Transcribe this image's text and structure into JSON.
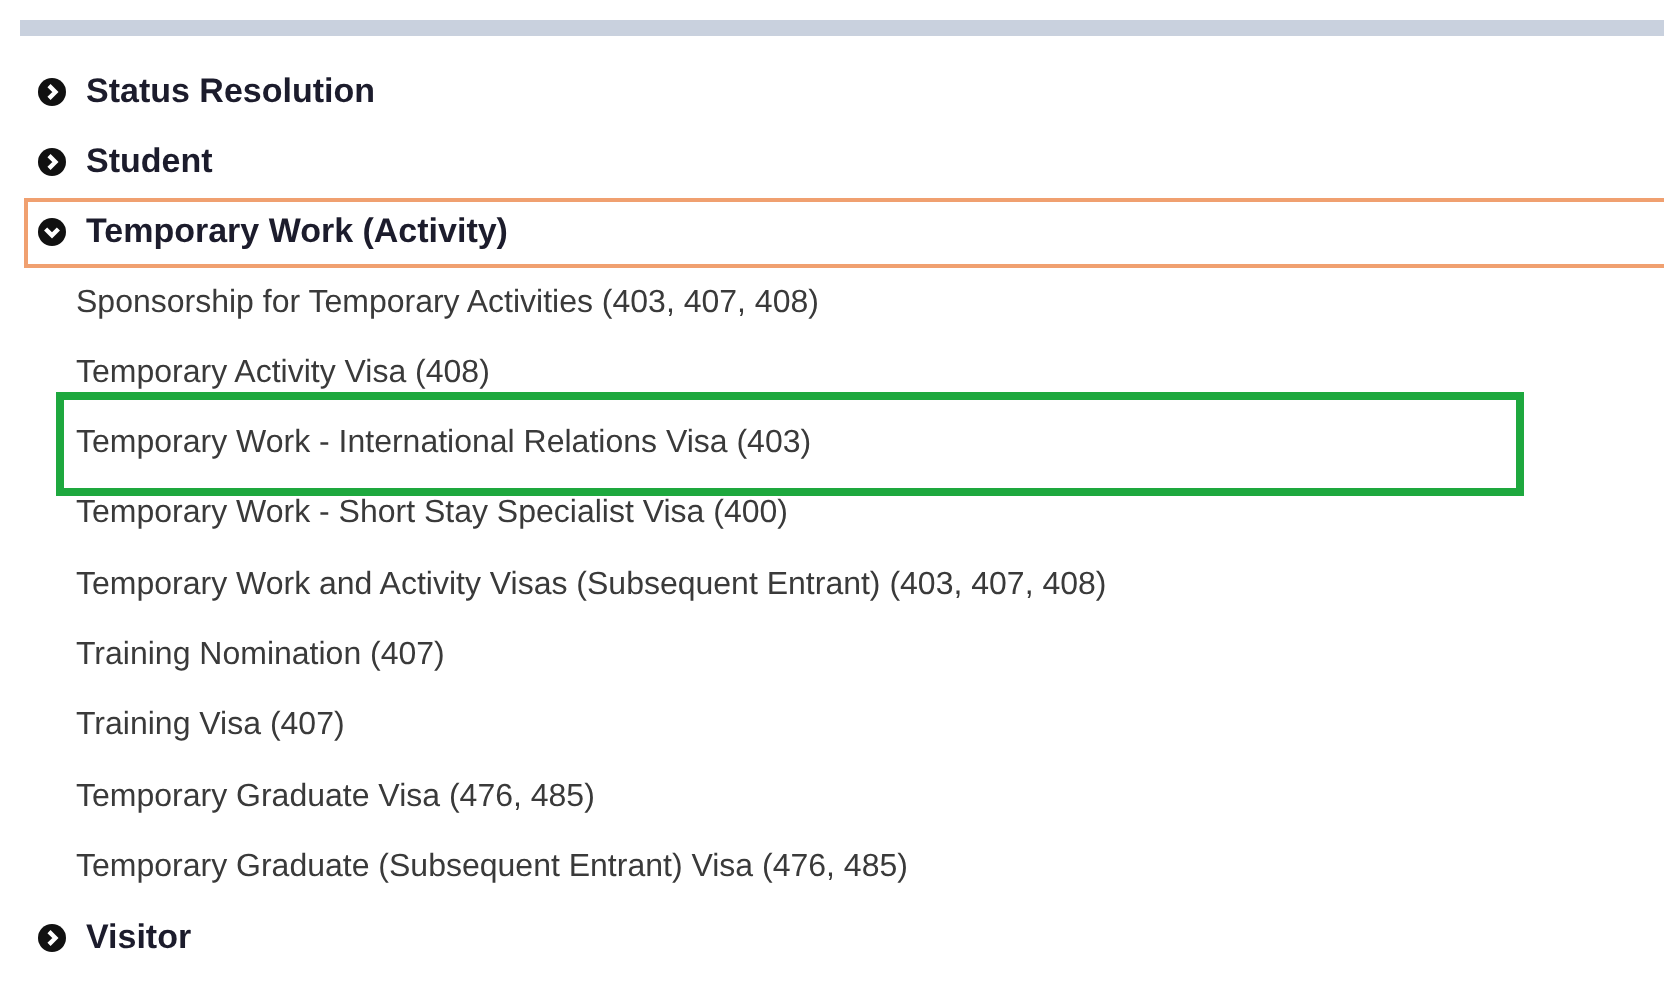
{
  "categories": [
    {
      "label": "Status Resolution",
      "expanded": false,
      "outlined": false
    },
    {
      "label": "Student",
      "expanded": false,
      "outlined": false
    },
    {
      "label": "Temporary Work (Activity)",
      "expanded": true,
      "outlined": true,
      "items": [
        {
          "label": "Sponsorship for Temporary Activities (403, 407, 408)",
          "boxed": false
        },
        {
          "label": "Temporary Activity Visa (408)",
          "boxed": false
        },
        {
          "label": "Temporary Work - International Relations Visa (403)",
          "boxed": true
        },
        {
          "label": "Temporary Work - Short Stay Specialist Visa (400)",
          "boxed": false
        },
        {
          "label": "Temporary Work and Activity Visas (Subsequent Entrant) (403, 407, 408)",
          "boxed": false
        },
        {
          "label": "Training Nomination (407)",
          "boxed": false
        },
        {
          "label": "Training Visa (407)",
          "boxed": false
        },
        {
          "label": "Temporary Graduate Visa (476, 485)",
          "boxed": false
        },
        {
          "label": "Temporary Graduate (Subsequent Entrant) Visa (476, 485)",
          "boxed": false
        }
      ]
    },
    {
      "label": "Visitor",
      "expanded": false,
      "outlined": false
    }
  ]
}
